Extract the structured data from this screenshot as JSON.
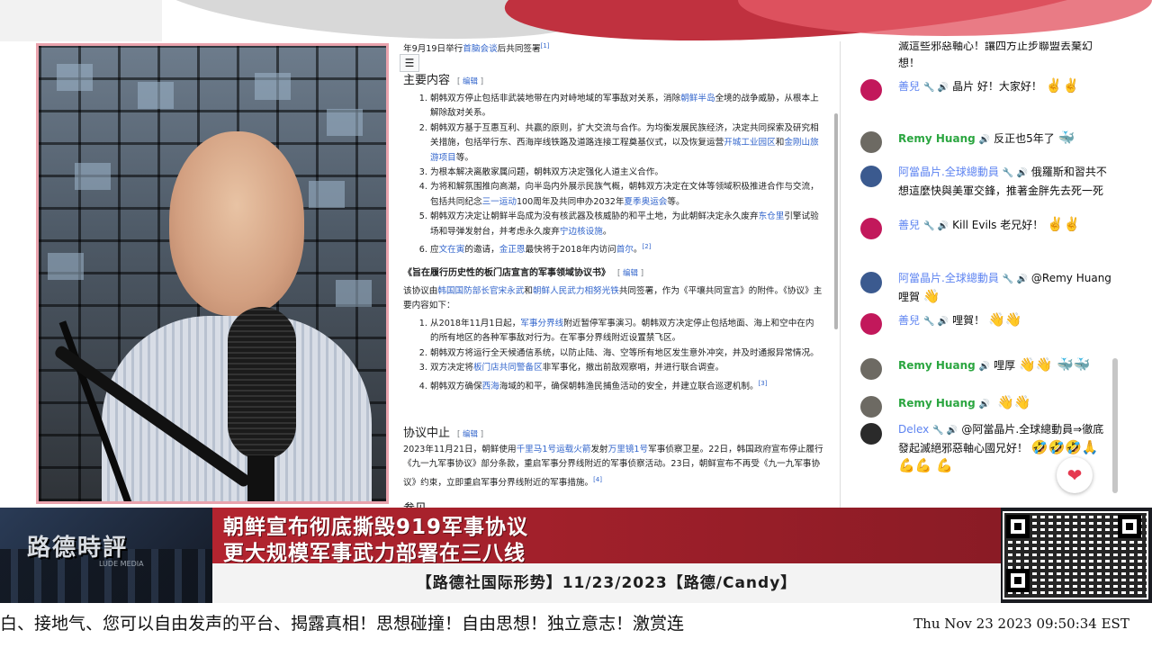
{
  "wiki": {
    "top_line_prefix": "年9月19日举行",
    "top_line_link": "首脑会谈",
    "top_line_suffix": "后共同签署",
    "top_line_ref": "[1]",
    "edit_label": "编辑",
    "section1_title": "主要内容",
    "section1_items": [
      {
        "parts": [
          "朝韩双方停止包括非武装地带在内对峙地域的军事敌对关系，消除",
          "朝鲜半岛",
          "全境的战争威胁，从根本上解除敌对关系。"
        ]
      },
      {
        "parts": [
          "朝韩双方基于互惠互利、共赢的原则，扩大交流与合作。为均衡发展民族经济，决定共同探索及研究相关措施，包括举行东、西海岸线铁路及道路连接工程奠基仪式，以及恢复运营",
          "开城工业园区",
          "和",
          "金刚山旅游项目",
          "等。"
        ]
      },
      {
        "parts": [
          "为根本解决离散家属问题，朝韩双方决定强化人道主义合作。"
        ]
      },
      {
        "parts": [
          "为将和解氛围推向高潮，向半岛内外展示民族气概，朝韩双方决定在文体等领域积极推进合作与交流，包括共同纪念",
          "三一运动",
          "100周年及共同申办2032年",
          "夏季奥运会",
          "等。"
        ]
      },
      {
        "parts": [
          "朝韩双方决定让朝鲜半岛成为没有核武器及核威胁的和平土地，为此朝鲜决定永久废弃",
          "东仓里",
          "引擎试验场和导弹发射台，并考虑永久废弃",
          "宁边核设施",
          "。"
        ]
      },
      {
        "parts": [
          "应",
          "文在寅",
          "的邀请，",
          "金正恩",
          "最快将于2018年内访问",
          "首尔",
          "。",
          "[2]"
        ]
      }
    ],
    "section2_title": "《旨在履行历史性的板门店宣言的军事领域协议书》",
    "section2_intro_parts": [
      "该协议由",
      "韩国国防部长官宋永武",
      "和",
      "朝鲜人民武力相努光铁",
      "共同签署，作为《平壤共同宣言》的附件。《协议》主要内容如下："
    ],
    "section2_items": [
      {
        "parts": [
          "从2018年11月1日起，",
          "军事分界线",
          "附近暂停军事演习。朝韩双方决定停止包括地面、海上和空中在内的所有地区的各种军事敌对行为。在军事分界线附近设置禁飞区。"
        ]
      },
      {
        "parts": [
          "朝韩双方将运行全天候通信系统，以防止陆、海、空等所有地区发生意外冲突，并及时通报异常情况。"
        ]
      },
      {
        "parts": [
          "双方决定将",
          "板门店共同警备区",
          "非军事化，撤出前敌观察哨，并进行联合调查。"
        ]
      },
      {
        "parts": [
          "朝韩双方确保",
          "西海",
          "海域的和平，确保朝韩渔民捕鱼活动的安全，并建立联合巡逻机制。",
          "[3]"
        ]
      }
    ],
    "section3_title": "协议中止",
    "section3_parts": [
      "2023年11月21日，朝鲜使用",
      "千里马1号运载火箭",
      "发射",
      "万里镜1号",
      "军事侦察卫星。22日，韩国政府宣布停止履行《九一九军事协议》部分条款，重启军事分界线附近的军事侦察活动。23日，朝鲜宣布不再受《九一九军事协议》约束，立即重启军事分界线附近的军事措施。",
      "[4]"
    ],
    "next_heading_fragment": "参见"
  },
  "chat": {
    "top_fragment": "滅這些邪惡軸心！讓四方止步聯盟丟棄幻想！",
    "messages": [
      {
        "author": "善兒",
        "member": true,
        "badges": "🔧 🔊",
        "text": "晶片 好！大家好！",
        "emoji": "✌️✌️",
        "avatar": "#c2185b"
      },
      {
        "author": "Remy Huang",
        "member": false,
        "badges": "🔊",
        "text": "反正也5年了",
        "emoji": "🐳",
        "avatar": "#6d6a63"
      },
      {
        "author": "阿當晶片.全球總動員",
        "member": true,
        "badges": "🔧 🔊",
        "text": "俄羅斯和習共不想這麼快與美軍交鋒，推著金胖先去死一死",
        "emoji": "",
        "avatar": "#3b5a8f"
      },
      {
        "author": "善兒",
        "member": true,
        "badges": "🔧 🔊",
        "text": "Kill Evils 老兄好！",
        "emoji": "✌️✌️",
        "avatar": "#c2185b"
      },
      {
        "author": "阿當晶片.全球總動員",
        "member": true,
        "badges": "🔧 🔊",
        "text": "@Remy Huang 哩賀",
        "emoji": "👋",
        "avatar": "#3b5a8f"
      },
      {
        "author": "善兒",
        "member": true,
        "badges": "🔧 🔊",
        "text": "哩賀！",
        "emoji": "👋👋",
        "avatar": "#c2185b"
      },
      {
        "author": "Remy Huang",
        "member": false,
        "badges": "🔊",
        "text": "哩厚",
        "emoji": "👋👋 🐳🐳",
        "avatar": "#6d6a63"
      },
      {
        "author": "Remy Huang",
        "member": false,
        "badges": "🔊",
        "text": "",
        "emoji": "👋👋",
        "avatar": "#6d6a63"
      },
      {
        "author": "Delex",
        "member": true,
        "badges": "🔧 🔊",
        "text": "@阿當晶片.全球總動員⇒徹底發起滅絕邪惡軸心國兄好！",
        "emoji": "🤣🤣🤣🙏💪💪 💪",
        "avatar": "#2a2a2a"
      }
    ],
    "heart": "❤"
  },
  "lower_third": {
    "logo": "路德時評",
    "logo_sub": "LUDE MEDIA",
    "headline_line1": "朝鲜宣布彻底撕毁919军事协议",
    "headline_line2": "更大规模军事武力部署在三八线",
    "subtitle": "【路德社国际形势】11/23/2023【路德/Candy】"
  },
  "ticker": {
    "text": "白、接地气、您可以自由发声的平台、揭露真相！思想碰撞！自由思想！独立意志！激赏连",
    "datetime": "Thu Nov 23 2023 09:50:34 EST"
  },
  "colors": {
    "accent_red": "#b3242f",
    "link_blue": "#3366cc",
    "chat_member": "#5e84f1",
    "chat_green": "#2ba640"
  },
  "icons": {
    "toc": "list-icon",
    "heart": "heart-icon",
    "wrench": "wrench-icon",
    "speaker": "speaker-icon"
  }
}
